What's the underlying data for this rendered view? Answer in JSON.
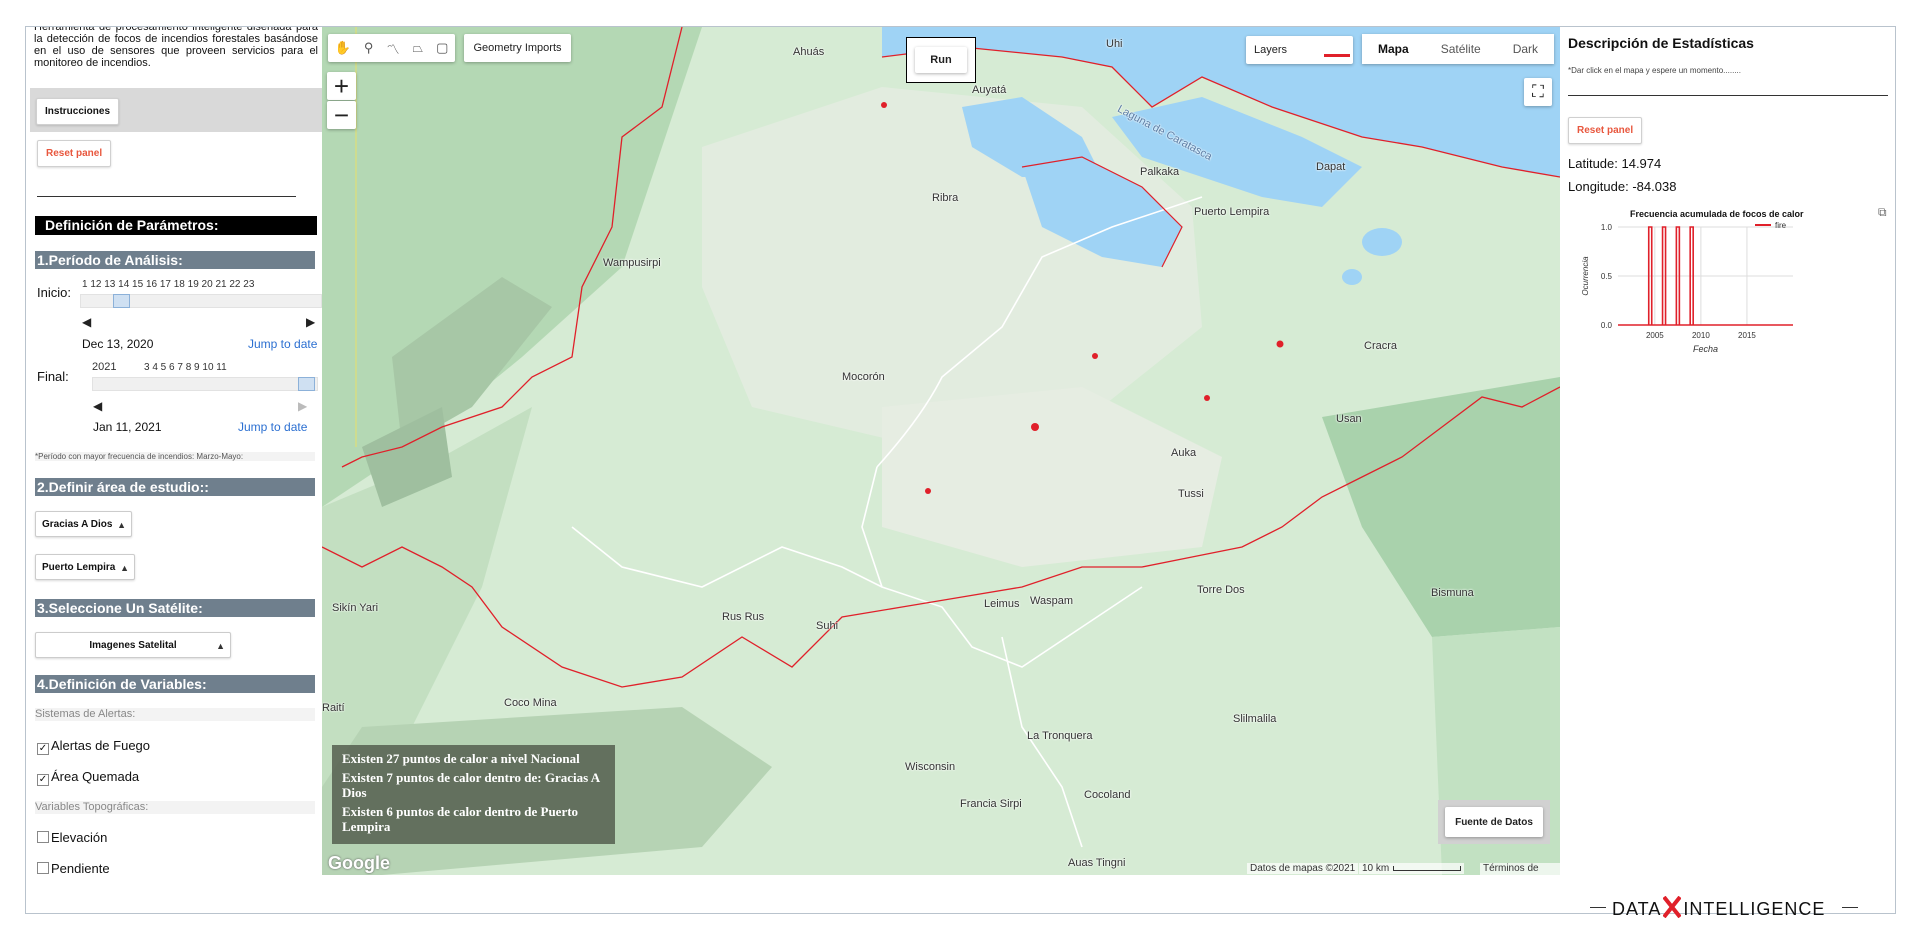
{
  "left_panel": {
    "intro": "Herramienta de procesamiento inteligente diseñada para la detección de focos de incendios forestales basándose en el uso de sensores que proveen servicios para el monitoreo de incendios.",
    "instructions_btn": "Instrucciones",
    "reset_btn": "Reset panel",
    "params_title": "Definición de Parámetros:",
    "period_title": "1.Período de Análisis:",
    "inicio_label": "Inicio:",
    "inicio_ticks": "1  12  13  14  15  16  17  18  19  20  21  22  23",
    "inicio_date": "Dec 13, 2020",
    "jump_label": "Jump to date",
    "final_label": "Final:",
    "final_year": "2021",
    "final_ticks": "3   4   5   6   7   8   9   10  11",
    "final_date": "Jan 11, 2021",
    "period_note": "*Período con mayor frecuencia de incendios: Marzo-Mayo:",
    "area_title": "2.Definir área de estudio::",
    "department": "Gracias A Dios",
    "municipality": "Puerto Lempira",
    "satellite_title": "3.Seleccione Un Satélite:",
    "satellite": "Imagenes Satelital",
    "variables_title": "4.Definición de Variables:",
    "alerts_title": "Sistemas de Alertas:",
    "fire_alerts": "Alertas de Fuego",
    "burned_area": "Área Quemada",
    "topo_title": "Variables Topográficas:",
    "elevation": "Elevación",
    "slope": "Pendiente"
  },
  "map": {
    "geometry_imports": "Geometry Imports",
    "run_btn": "Run",
    "layers_label": "Layers",
    "map_types": [
      "Mapa",
      "Satélite",
      "Dark"
    ],
    "zoom_in": "+",
    "zoom_out": "−",
    "places": [
      "Ahuás",
      "Auyatá",
      "Ribra",
      "Palkaka",
      "Puerto Lempira",
      "Wampusirpi",
      "Mocorón",
      "Cracra",
      "Usan",
      "Auka",
      "Tussi",
      "Sikín Yari",
      "Rus Rus",
      "Suhi",
      "Leimus",
      "Waspam",
      "Torre Dos",
      "Bismuna",
      "Coco Mina",
      "Raití",
      "Wisconsin",
      "La Tronquera",
      "Slilmalila",
      "Francia Sirpi",
      "Cocoland",
      "Auas Tingni",
      "Laguna de Caratasca",
      "Uhi",
      "Dapat"
    ],
    "info_lines": [
      "Existen 27 puntos de calor a nivel Nacional",
      "Existen 7 puntos de calor dentro de: Gracias A Dios",
      "Existen 6 puntos de calor dentro de Puerto Lempira"
    ],
    "fuente_btn": "Fuente de Datos",
    "attribution": "Datos de mapas ©2021",
    "scale": "10 km",
    "terms": "Términos de uso",
    "google": "Google",
    "colors": {
      "water": "#9fd3f5",
      "land": "#d6ebd4",
      "border": "#e0202a",
      "fire": "#e0202a"
    }
  },
  "right_panel": {
    "title": "Descripción de Estadísticas",
    "subtitle": "*Dar click en el mapa y espere un momento........",
    "reset_btn": "Reset panel",
    "latitude": "Latitude: 14.974",
    "longitude": "Longitude: -84.038"
  },
  "chart_data": {
    "type": "line",
    "title": "Frecuencia acumulada de focos de calor",
    "xlabel": "Fecha",
    "ylabel": "Ocurrencia",
    "xlim": [
      2001,
      2020
    ],
    "ylim": [
      0,
      1
    ],
    "x_ticks": [
      2005,
      2010,
      2015
    ],
    "y_ticks": [
      "0.0",
      "0.5",
      "1.0"
    ],
    "series": [
      {
        "name": "fire",
        "color": "#e0202a",
        "spikes_x": [
          2004.5,
          2006,
          2007.5,
          2009
        ],
        "values_at_spikes": [
          1,
          1,
          1,
          1
        ]
      }
    ],
    "legend": "top-right",
    "grid": true
  },
  "footer": {
    "logo_left": "DATA",
    "logo_right": "INTELLIGENCE"
  }
}
